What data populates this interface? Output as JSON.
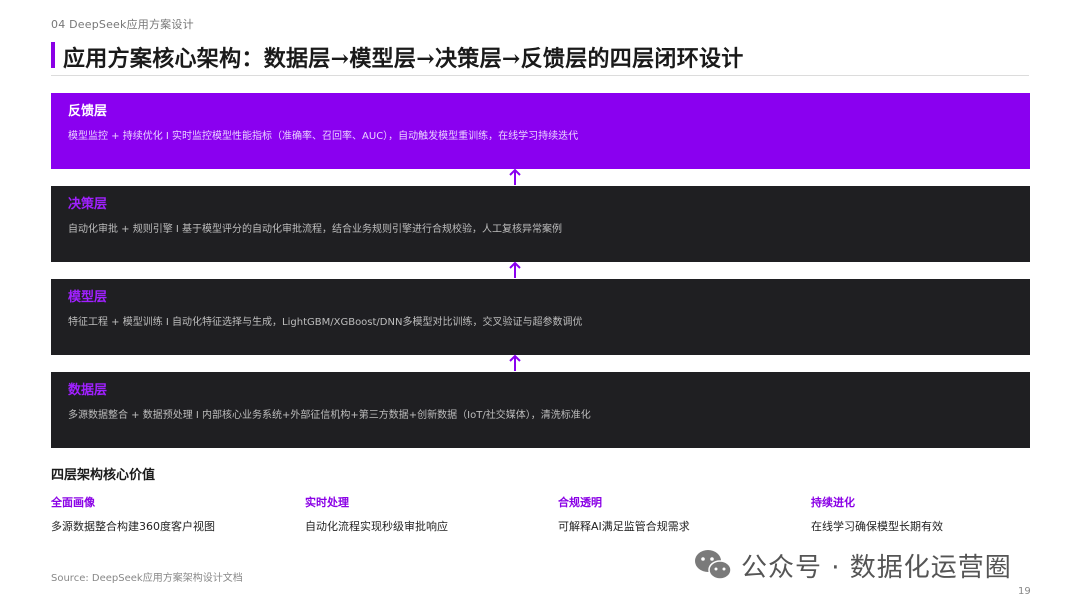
{
  "header": {
    "section": "04 DeepSeek应用方案设计",
    "title": "应用方案核心架构：数据层→模型层→决策层→反馈层的四层闭环设计"
  },
  "layers": [
    {
      "name": "反馈层",
      "desc": "模型监控 + 持续优化 I 实时监控模型性能指标（准确率、召回率、AUC），自动触发模型重训练，在线学习持续迭代"
    },
    {
      "name": "决策层",
      "desc": "自动化审批 + 规则引擎 I 基于模型评分的自动化审批流程，结合业务规则引擎进行合规校验，人工复核异常案例"
    },
    {
      "name": "模型层",
      "desc": "特征工程 + 模型训练 I 自动化特征选择与生成，LightGBM/XGBoost/DNN多模型对比训练，交叉验证与超参数调优"
    },
    {
      "name": "数据层",
      "desc": "多源数据整合 + 数据预处理 I 内部核心业务系统+外部征信机构+第三方数据+创新数据（IoT/社交媒体），清洗标准化"
    }
  ],
  "values": {
    "title": "四层架构核心价值",
    "items": [
      {
        "head": "全面画像",
        "text": "多源数据整合构建360度客户视图"
      },
      {
        "head": "实时处理",
        "text": "自动化流程实现秒级审批响应"
      },
      {
        "head": "合规透明",
        "text": "可解释AI满足监管合规需求"
      },
      {
        "head": "持续进化",
        "text": "在线学习确保模型长期有效"
      }
    ]
  },
  "footer": {
    "source": "Source: DeepSeek应用方案架构设计文档",
    "watermark": "公众号 · 数据化运营圈",
    "page": "19"
  },
  "colors": {
    "accent": "#8a00f0",
    "dark": "#1f1f22"
  },
  "icons": {
    "arrow": "arrow-up-icon",
    "watermark": "wechat-icon"
  }
}
